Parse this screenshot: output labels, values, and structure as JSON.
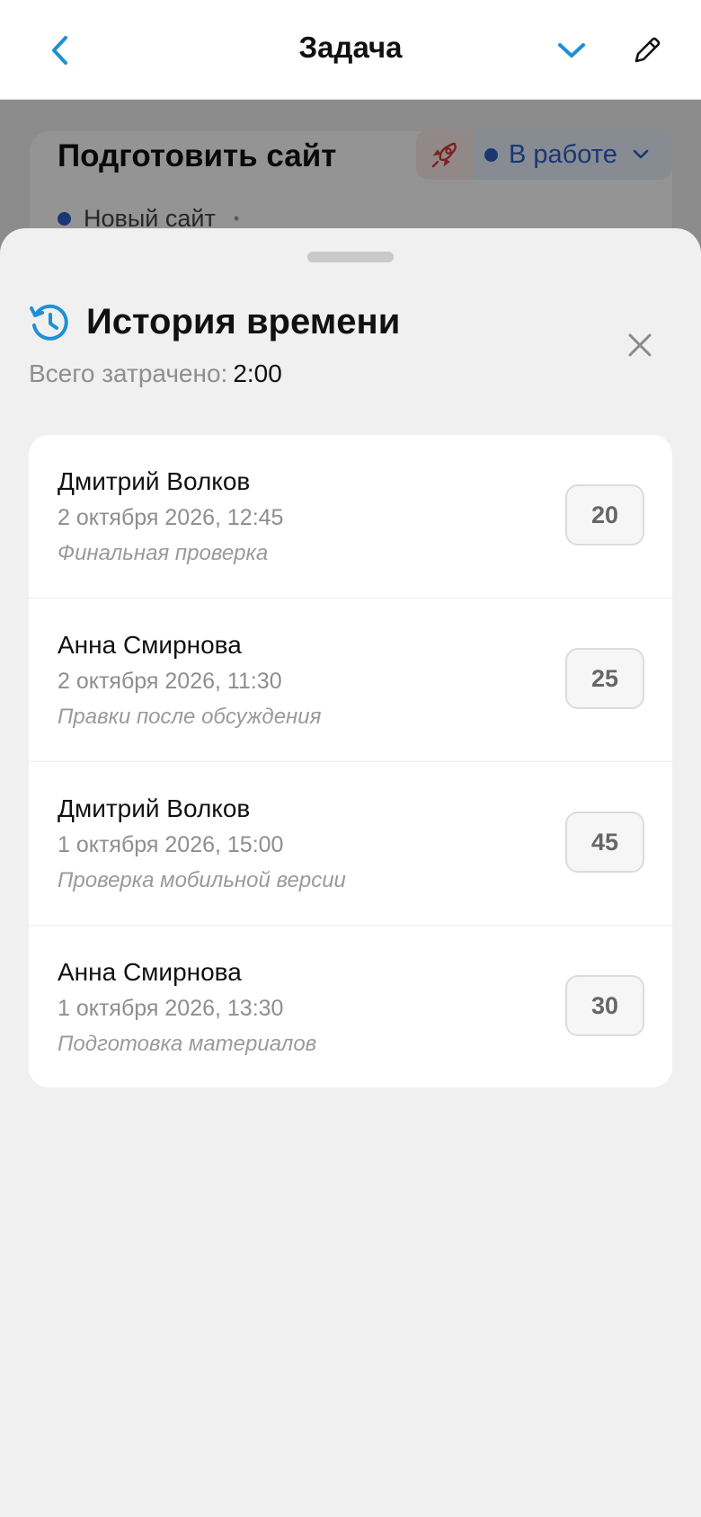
{
  "navbar": {
    "title": "Задача",
    "icons": {
      "back": "chevron-left-icon",
      "collapse": "chevron-down-icon",
      "edit": "pencil-icon"
    }
  },
  "task": {
    "title": "Подготовить сайт",
    "status": "В работе",
    "project": "Новый сайт",
    "icons": {
      "priority": "rocket-icon"
    }
  },
  "sheet": {
    "title": "История времени",
    "total_label": "Всего затрачено:",
    "total_value": "2:00",
    "icons": {
      "history": "history-clock-icon",
      "close": "close-icon"
    },
    "entries": [
      {
        "name": "Дмитрий Волков",
        "date": "2 октября 2026, 12:45",
        "note": "Финальная проверка",
        "minutes": "20"
      },
      {
        "name": "Анна Смирнова",
        "date": "2 октября 2026, 11:30",
        "note": "Правки после обсуждения",
        "minutes": "25"
      },
      {
        "name": "Дмитрий Волков",
        "date": "1 октября 2026, 15:00",
        "note": "Проверка мобильной версии",
        "minutes": "45"
      },
      {
        "name": "Анна Смирнова",
        "date": "1 октября 2026, 13:30",
        "note": "Подготовка материалов",
        "minutes": "30"
      }
    ]
  },
  "colors": {
    "accent": "#1f8fd6",
    "status_blue": "#2d5fc8",
    "rocket_red": "#d23a3a",
    "sheet_bg": "#f0f0f0"
  }
}
